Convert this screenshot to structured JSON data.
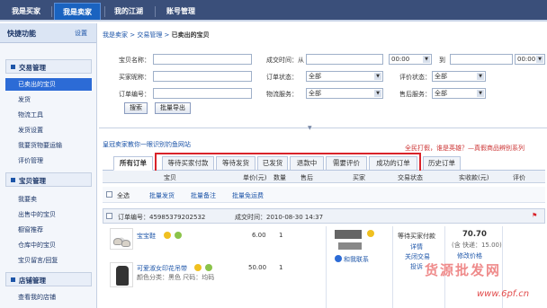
{
  "topnav": {
    "tabs": [
      {
        "label": "我是买家"
      },
      {
        "label": "我是卖家"
      },
      {
        "label": "我的江湖"
      },
      {
        "label": "账号管理"
      }
    ]
  },
  "sidebar": {
    "title": "快捷功能",
    "settings": "设置",
    "groups": [
      {
        "title": "交易管理",
        "items": [
          "已卖出的宝贝",
          "发货",
          "物流工具",
          "发货设置",
          "我要货物要运输",
          "评价管理"
        ]
      },
      {
        "title": "宝贝管理",
        "items": [
          "我要卖",
          "出售中的宝贝",
          "橱窗推荐",
          "仓库中的宝贝",
          "宝贝留言/回复"
        ]
      },
      {
        "title": "店铺管理",
        "items": [
          "查看我的店铺"
        ]
      }
    ]
  },
  "breadcrumb": {
    "part1": "我是卖家",
    "part2": "交易管理",
    "part3": "已卖出的宝贝"
  },
  "form": {
    "item_name": "宝贝名称：",
    "buyer_nick": "买家昵称：",
    "order_no": "订单编号：",
    "deal_time_from": "成交时间：从",
    "to": "到",
    "trade_status": "订单状态：",
    "logistics": "物流服务：",
    "rate_status": "评价状态：",
    "after_sale": "售后服务：",
    "all": "全部",
    "time_value": "00:00",
    "search_btn": "搜索",
    "export_btn": "批量导出"
  },
  "promo": "皇冠卖家教你一眼识别钓鱼网站",
  "alert": "全民打假，谁是英雄？—真假商品辨别系列",
  "order_tabs": [
    {
      "label": "所有订单"
    },
    {
      "label": "等待买家付款"
    },
    {
      "label": "等待发货"
    },
    {
      "label": "已发货"
    },
    {
      "label": "退款中"
    },
    {
      "label": "需要评价"
    },
    {
      "label": "成功的订单"
    },
    {
      "label": "历史订单"
    }
  ],
  "columns": {
    "item": "宝贝",
    "price": "单价(元)",
    "qty": "数量",
    "after_sale": "售后",
    "buyer": "买家",
    "status": "交易状态",
    "paid": "实收款(元)",
    "rate": "评价"
  },
  "select_row": {
    "select_all": "全选",
    "batch_ship": "批量发货",
    "batch_note": "批量备注",
    "batch_free": "批量免运费"
  },
  "order": {
    "no_label": "订单编号：45985379202532",
    "time_label": "成交时间：2010-08-30  14:37"
  },
  "items": [
    {
      "name": "宝宝鞋",
      "price": "6.00",
      "qty": "1"
    },
    {
      "name": "可爱淑女印花吊带",
      "spec": "颜色分类：黑色   尺码：均码",
      "price": "50.00",
      "qty": "1"
    }
  ],
  "buyer": {
    "contact": "和我联系"
  },
  "status": {
    "text": "等待买家付款",
    "detail": "详情",
    "close": "关闭交易",
    "complain": "投诉"
  },
  "paid": {
    "amount": "70.70",
    "note": "(含 快递：15.00)",
    "modify": "修改价格"
  },
  "watermark": {
    "text": "货源批发网",
    "url": "www.6pf.cn"
  }
}
